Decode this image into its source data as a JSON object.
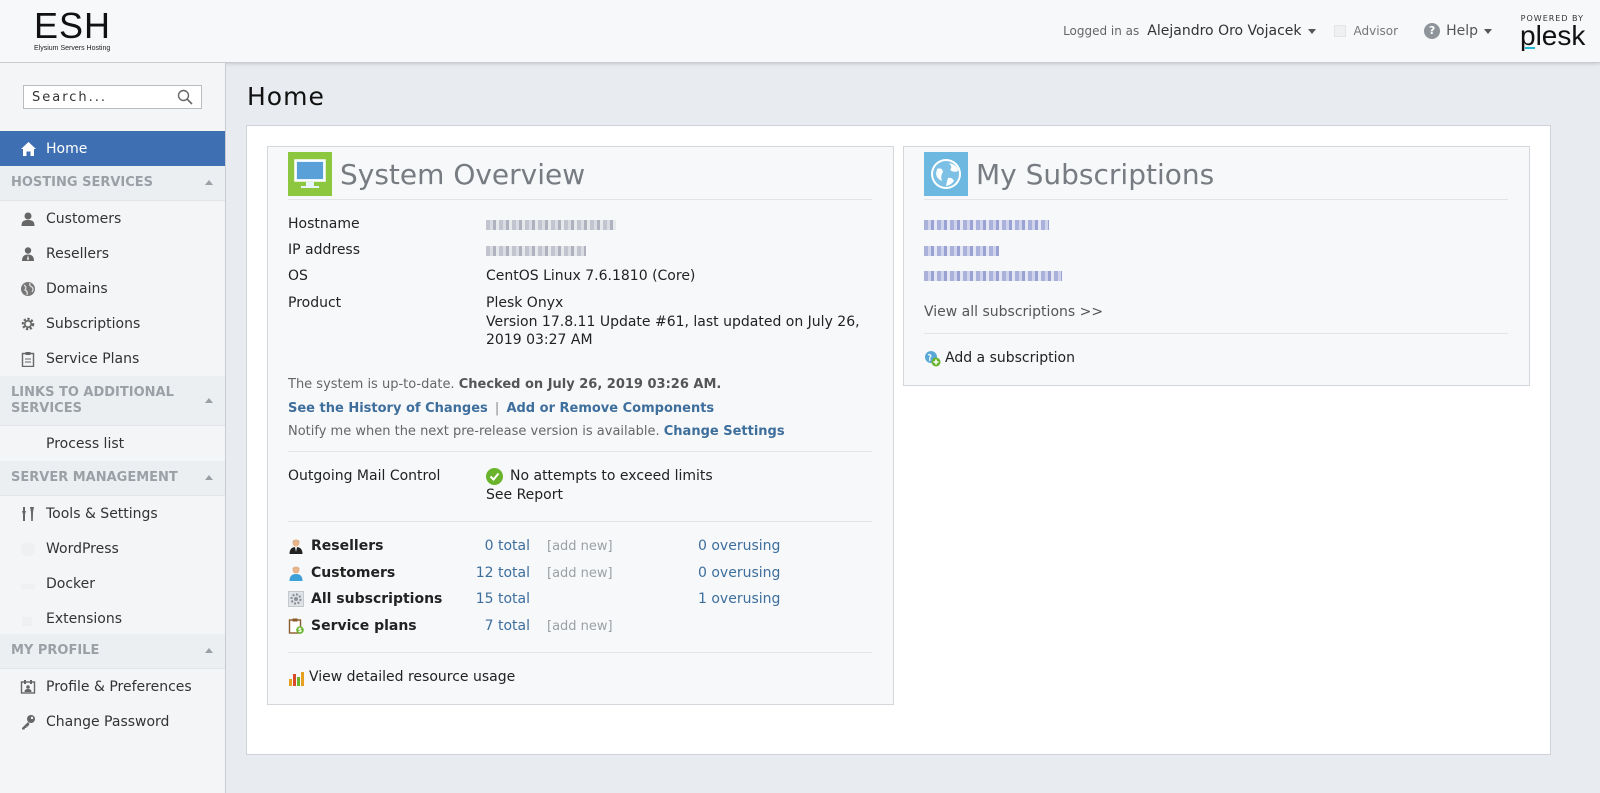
{
  "header": {
    "logo_text": "ESH",
    "logo_subtext": "Elysium Servers Hosting",
    "logged_in_label": "Logged in as",
    "user_name": "Alejandro Oro Vojacek",
    "advisor_label": "Advisor",
    "help_label": "Help",
    "powered_by": "POWERED BY",
    "plesk_logo": "plesk"
  },
  "sidebar": {
    "search_placeholder": "Search...",
    "home_label": "Home",
    "sections": [
      {
        "title": "HOSTING SERVICES",
        "items": [
          {
            "label": "Customers",
            "icon": "user-icon"
          },
          {
            "label": "Resellers",
            "icon": "reseller-icon"
          },
          {
            "label": "Domains",
            "icon": "globe-icon"
          },
          {
            "label": "Subscriptions",
            "icon": "gear-icon"
          },
          {
            "label": "Service Plans",
            "icon": "clipboard-icon"
          }
        ]
      },
      {
        "title": "LINKS TO ADDITIONAL SERVICES",
        "items": [
          {
            "label": "Process list",
            "icon": "process-icon"
          }
        ]
      },
      {
        "title": "SERVER MANAGEMENT",
        "items": [
          {
            "label": "Tools & Settings",
            "icon": "tools-icon"
          },
          {
            "label": "WordPress",
            "icon": "wordpress-icon"
          },
          {
            "label": "Docker",
            "icon": "docker-icon"
          },
          {
            "label": "Extensions",
            "icon": "extensions-icon"
          }
        ]
      },
      {
        "title": "MY PROFILE",
        "items": [
          {
            "label": "Profile & Preferences",
            "icon": "profile-icon"
          },
          {
            "label": "Change Password",
            "icon": "key-icon"
          }
        ]
      }
    ]
  },
  "main": {
    "page_title": "Home",
    "system_overview": {
      "title": "System Overview",
      "rows": [
        {
          "label": "Hostname",
          "value": ""
        },
        {
          "label": "IP address",
          "value": ""
        },
        {
          "label": "OS",
          "value": "CentOS Linux 7.6.1810 (Core)"
        },
        {
          "label": "Product",
          "value": "Plesk Onyx",
          "value2": "Version 17.8.11 Update #61, last updated on July 26,",
          "value3": "2019 03:27 AM"
        }
      ],
      "status_text": "The system is up-to-date.",
      "status_checked": "Checked on July 26, 2019 03:26 AM.",
      "history_link": "See the History of Changes",
      "separator": "|",
      "components_link": "Add or Remove Components",
      "notify_text": "Notify me when the next pre-release version is available.",
      "change_settings_link": "Change Settings",
      "mail_control_label": "Outgoing Mail Control",
      "mail_status": "No attempts to exceed limits",
      "see_report_link": "See Report",
      "stats": [
        {
          "label": "Resellers",
          "total": "0 total",
          "add": "[add new]",
          "over": "0 overusing"
        },
        {
          "label": "Customers",
          "total": "12 total",
          "add": "[add new]",
          "over": "0 overusing"
        },
        {
          "label": "All subscriptions",
          "total": "15 total",
          "add": "",
          "over": "1 overusing"
        },
        {
          "label": "Service plans",
          "total": "7 total",
          "add": "[add new]",
          "over": ""
        }
      ],
      "resource_link": "View detailed resource usage"
    },
    "subscriptions": {
      "title": "My Subscriptions",
      "view_all_link": "View all subscriptions >>",
      "add_link": "Add a subscription"
    }
  },
  "colors": {
    "accent": "#3e6fb2",
    "link": "#3d6e9c",
    "ok_green": "#6ab42d"
  }
}
